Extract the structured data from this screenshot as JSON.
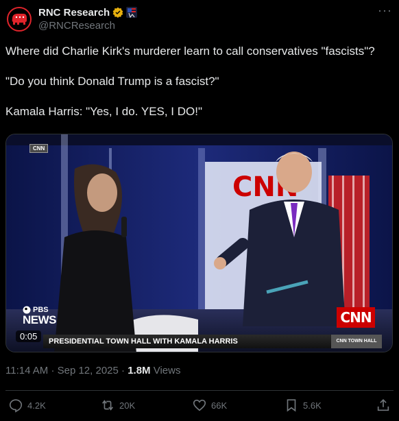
{
  "author": {
    "display_name": "RNC Research",
    "handle": "@RNCResearch"
  },
  "tweet": {
    "paragraphs": [
      "Where did Charlie Kirk's murderer learn to call conservatives \"fascists\"?",
      "\"Do you think Donald Trump is a fascist?\"",
      "Kamala Harris: \"Yes, I do. YES, I DO!\""
    ]
  },
  "video": {
    "cnn_small_label": "CNN",
    "pbs_top": "PBS",
    "pbs_news": "NEWS",
    "timecode": "0:05",
    "lower_third": "PRESIDENTIAL TOWN HALL WITH KAMALA HARRIS",
    "lower_third_right": "CNN TOWN HALL",
    "network_bug": "CNN"
  },
  "meta": {
    "time": "11:14 AM",
    "separator": "·",
    "date": "Sep 12, 2025",
    "views_count": "1.8M",
    "views_label": "Views"
  },
  "actions": {
    "replies": "4.2K",
    "reposts": "20K",
    "likes": "66K",
    "bookmarks": "5.6K"
  },
  "colors": {
    "background": "#000000",
    "text": "#e7e9ea",
    "muted": "#71767b",
    "verified": "#e8b00e",
    "brand_red": "#e0242b"
  }
}
